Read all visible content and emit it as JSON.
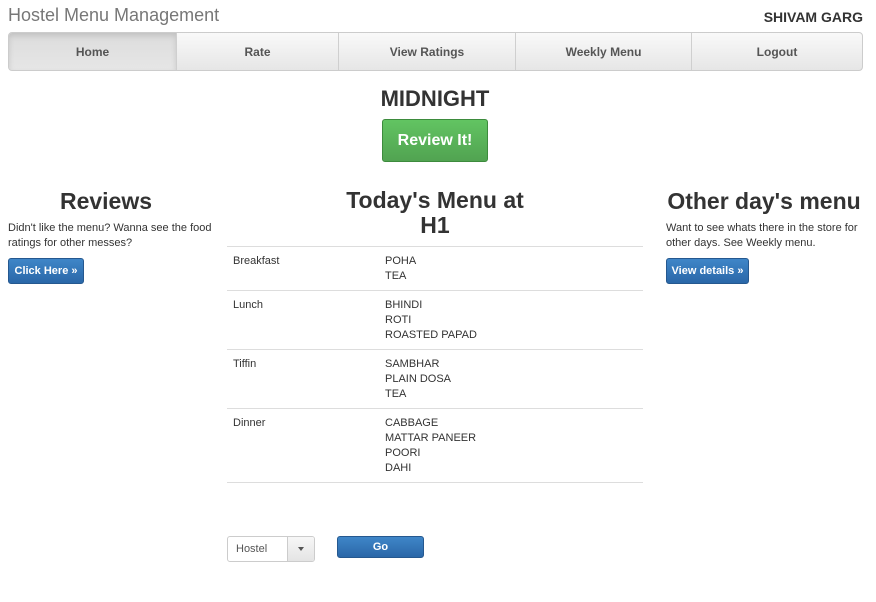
{
  "header": {
    "brand": "Hostel Menu Management",
    "user": "SHIVAM GARG"
  },
  "nav": {
    "items": [
      "Home",
      "Rate",
      "View Ratings",
      "Weekly Menu",
      "Logout"
    ],
    "active": "Home"
  },
  "main": {
    "meal_time": "MIDNIGHT",
    "review_button": "Review It!",
    "menu_heading": "Today's Menu at H1",
    "menu": [
      {
        "meal": "Breakfast",
        "items": [
          "POHA",
          "TEA"
        ]
      },
      {
        "meal": "Lunch",
        "items": [
          "BHINDI",
          "ROTI",
          "ROASTED PAPAD"
        ]
      },
      {
        "meal": "Tiffin",
        "items": [
          "SAMBHAR",
          "PLAIN DOSA",
          "TEA"
        ]
      },
      {
        "meal": "Dinner",
        "items": [
          "CABBAGE",
          "MATTAR PANEER",
          "POORI",
          "DAHI"
        ]
      }
    ]
  },
  "reviews": {
    "heading": "Reviews",
    "text": "Didn't like the menu? Wanna see the food ratings for other messes?",
    "button": "Click Here »"
  },
  "other_days": {
    "heading": "Other day's menu",
    "text": "Want to see whats there in the store for other days. See Weekly menu.",
    "button": "View details »"
  },
  "form": {
    "select_value": "Hostel",
    "go_button": "Go"
  },
  "colors": {
    "success": "#51a351",
    "primary": "#2a67a8"
  }
}
